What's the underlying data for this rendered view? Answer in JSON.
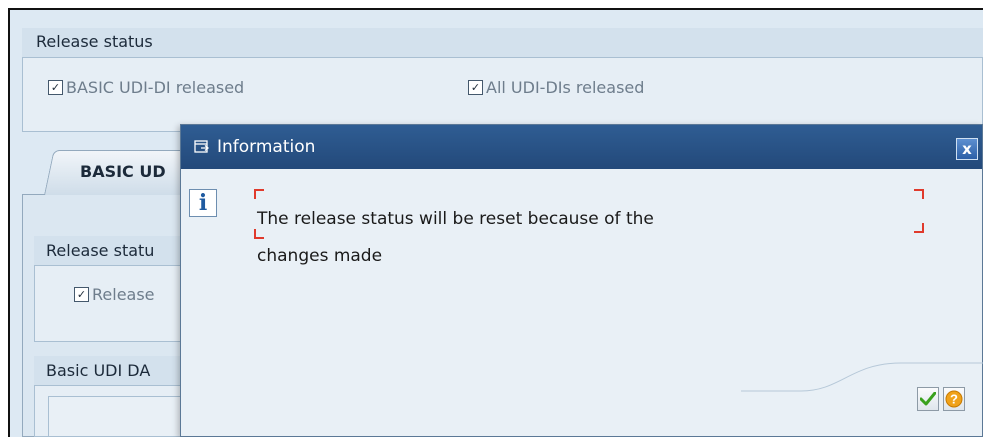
{
  "release_status": {
    "title": "Release status",
    "basic_udi_di_released": {
      "label": "BASIC UDI-DI released",
      "checked": true
    },
    "all_udi_dis_released": {
      "label": "All UDI-DIs released",
      "checked": true
    }
  },
  "tab": {
    "label": "BASIC UD"
  },
  "inner_release_status": {
    "title": "Release statu",
    "checkbox": {
      "label": "Release",
      "checked": true
    }
  },
  "basic_udi_data": {
    "title": "Basic UDI DA"
  },
  "dialog": {
    "title": "Information",
    "message_line1": "The release status will be reset because of the",
    "message_line2": "changes made",
    "close_label": "x",
    "icons": {
      "title": "dialog-window-icon",
      "info": "info-icon",
      "ok": "green-checkmark-icon",
      "help": "question-mark-icon"
    }
  },
  "colors": {
    "titlebar": "#2a5489",
    "accent_red": "#e03a2c",
    "ok_green": "#3aa11d",
    "help_orange": "#f0a21a"
  }
}
